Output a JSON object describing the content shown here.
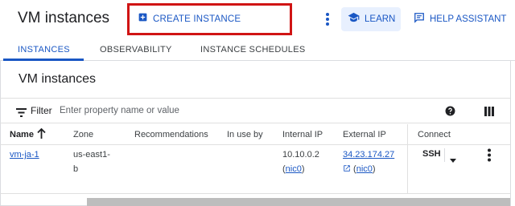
{
  "header": {
    "title": "VM instances",
    "create_label": "CREATE INSTANCE",
    "learn_label": "LEARN",
    "help_label": "HELP ASSISTANT"
  },
  "tabs": [
    {
      "label": "INSTANCES",
      "active": true
    },
    {
      "label": "OBSERVABILITY",
      "active": false
    },
    {
      "label": "INSTANCE SCHEDULES",
      "active": false
    }
  ],
  "section_title": "VM instances",
  "filter": {
    "label": "Filter",
    "placeholder": "Enter property name or value"
  },
  "table": {
    "columns": [
      "Name",
      "Zone",
      "Recommendations",
      "In use by",
      "Internal IP",
      "External IP",
      "Connect"
    ],
    "sort_column": "Name",
    "rows": [
      {
        "name": "vm-ja-1",
        "zone_line1": "us-east1-",
        "zone_line2": "b",
        "recommendations": "",
        "in_use_by": "",
        "internal_ip": "10.10.0.2",
        "internal_nic": "nic0",
        "external_ip": "34.23.174.27",
        "external_nic": "nic0",
        "connect": "SSH"
      }
    ]
  },
  "colors": {
    "accent": "#1a57c4",
    "highlight_box": "#d01414",
    "learn_bg": "#e8f0fe"
  },
  "icons": [
    "add-box-icon",
    "more-vert-icon",
    "school-icon",
    "chat-help-icon",
    "filter-list-icon",
    "help-circle-icon",
    "column-display-icon",
    "arrow-up-icon",
    "arrow-drop-down-icon",
    "open-in-new-icon"
  ]
}
